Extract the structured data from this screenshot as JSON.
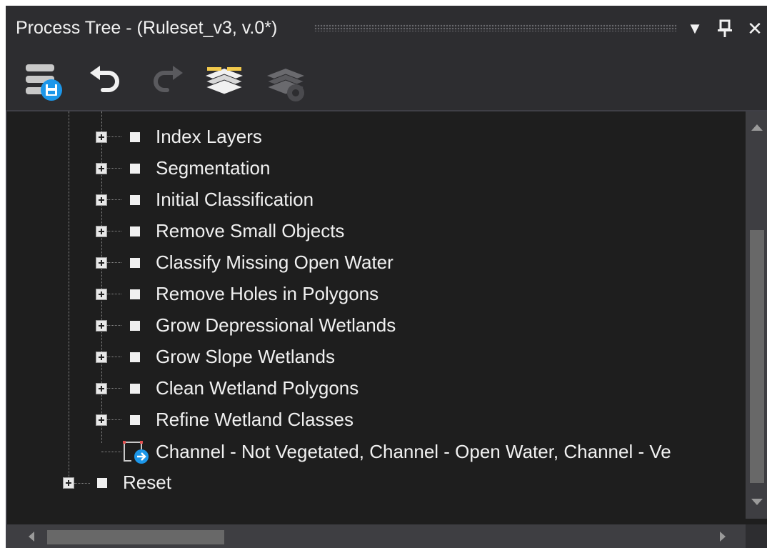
{
  "window": {
    "title": "Process Tree - (Ruleset_v3, v.0*)"
  },
  "titlebar_buttons": {
    "menu_glyph": "▼",
    "pin_glyph": "⊥",
    "close_glyph": "✕"
  },
  "toolbar": {
    "icons": [
      "save-ruleset-icon",
      "undo-icon",
      "redo-icon",
      "layers-icon",
      "layers-settings-icon"
    ]
  },
  "tree": {
    "children": [
      "Index Layers",
      "Segmentation",
      "Initial Classification",
      "Remove Small Objects",
      "Classify Missing Open Water",
      "Remove Holes in Polygons",
      "Grow Depressional Wetlands",
      "Grow Slope Wetlands",
      "Clean Wetland Polygons",
      "Refine Wetland Classes"
    ],
    "process_item": "Channel - Not Vegetated, Channel - Open Water, Channel - Ve",
    "reset": "Reset"
  },
  "colors": {
    "background": "#1e1e1e",
    "chrome": "#2d2d30",
    "text": "#f1f1f1",
    "accent_blue": "#1c97ea",
    "accent_yellow": "#f2c94c"
  }
}
